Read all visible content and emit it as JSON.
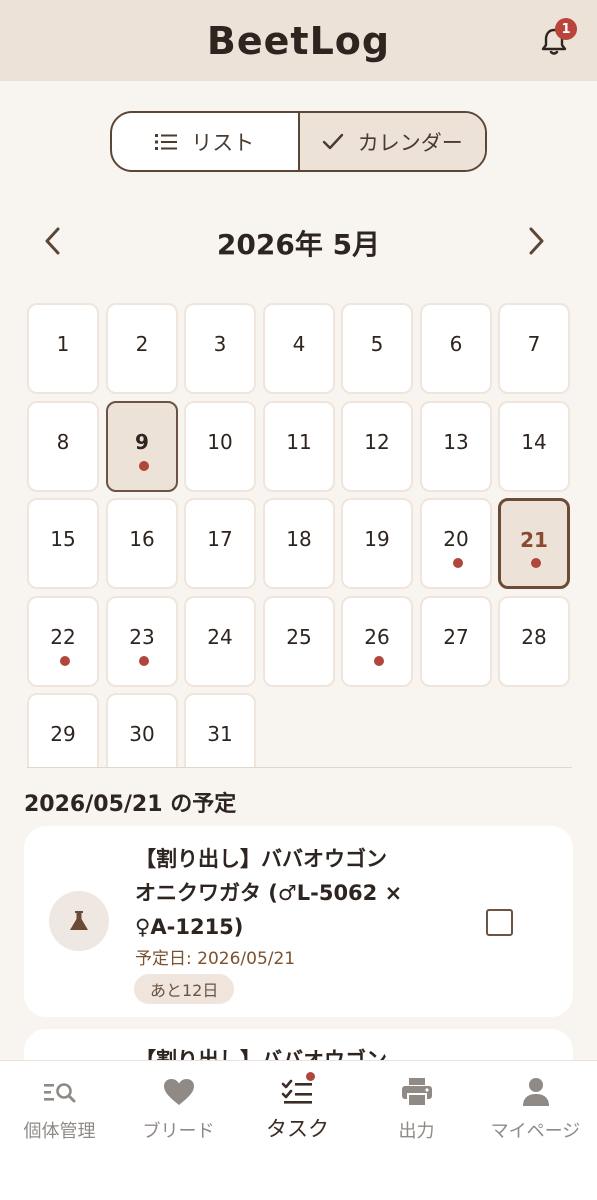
{
  "header": {
    "title": "BeetLog",
    "notification_count": "1"
  },
  "view_toggle": {
    "list_label": "リスト",
    "calendar_label": "カレンダー"
  },
  "calendar": {
    "month_title": "2026年 5月",
    "days": [
      {
        "n": "1",
        "dot": false
      },
      {
        "n": "2",
        "dot": false
      },
      {
        "n": "3",
        "dot": false
      },
      {
        "n": "4",
        "dot": false
      },
      {
        "n": "5",
        "dot": false
      },
      {
        "n": "6",
        "dot": false
      },
      {
        "n": "7",
        "dot": false
      },
      {
        "n": "8",
        "dot": false
      },
      {
        "n": "9",
        "dot": true,
        "state": "today"
      },
      {
        "n": "10",
        "dot": false
      },
      {
        "n": "11",
        "dot": false
      },
      {
        "n": "12",
        "dot": false
      },
      {
        "n": "13",
        "dot": false
      },
      {
        "n": "14",
        "dot": false
      },
      {
        "n": "15",
        "dot": false
      },
      {
        "n": "16",
        "dot": false
      },
      {
        "n": "17",
        "dot": false
      },
      {
        "n": "18",
        "dot": false
      },
      {
        "n": "19",
        "dot": false
      },
      {
        "n": "20",
        "dot": true
      },
      {
        "n": "21",
        "dot": true,
        "state": "selected"
      },
      {
        "n": "22",
        "dot": true
      },
      {
        "n": "23",
        "dot": true
      },
      {
        "n": "24",
        "dot": false
      },
      {
        "n": "25",
        "dot": false
      },
      {
        "n": "26",
        "dot": true
      },
      {
        "n": "27",
        "dot": false
      },
      {
        "n": "28",
        "dot": false
      },
      {
        "n": "29",
        "dot": false
      },
      {
        "n": "30",
        "dot": false
      },
      {
        "n": "31",
        "dot": false
      }
    ]
  },
  "schedule": {
    "title": "2026/05/21 の予定",
    "tasks": [
      {
        "line1": "【割り出し】ババオウゴン",
        "line2": "オニクワガタ (♂L-5062 ×",
        "line3": "♀A-1215)",
        "due": "予定日: 2026/05/21",
        "remaining": "あと12日",
        "icon": "flask-icon"
      },
      {
        "line1": "【割り出し】ババオウゴン"
      }
    ]
  },
  "bottom_nav": {
    "items": [
      {
        "label": "個体管理",
        "icon": "search-list-icon"
      },
      {
        "label": "ブリード",
        "icon": "heart-icon"
      },
      {
        "label": "タスク",
        "icon": "checklist-icon"
      },
      {
        "label": "出力",
        "icon": "printer-icon"
      },
      {
        "label": "マイページ",
        "icon": "user-icon"
      }
    ],
    "active_index": 2
  },
  "colors": {
    "accent": "#b0463c",
    "brown": "#6b5443",
    "header_bg": "#ede2d8"
  }
}
